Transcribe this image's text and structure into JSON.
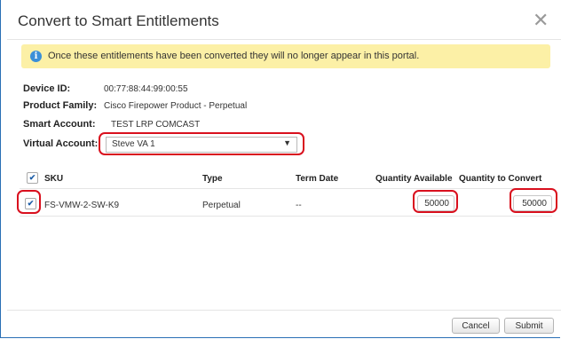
{
  "dialog": {
    "title": "Convert to Smart Entitlements",
    "close_glyph": "✕"
  },
  "alert": {
    "icon": "info-icon",
    "icon_glyph": "i",
    "message": "Once these entitlements have been converted they will no longer appear in this portal."
  },
  "fields": {
    "device_id_label": "Device ID:",
    "device_id_value": "00:77:88:44:99:00:55",
    "product_family_label": "Product Family:",
    "product_family_value": "Cisco Firepower Product - Perpetual",
    "smart_account_label": "Smart Account:",
    "smart_account_value": "TEST LRP COMCAST",
    "virtual_account_label": "Virtual Account:",
    "virtual_account_selected": "Steve VA 1",
    "caret_glyph": "▼"
  },
  "table": {
    "headers": {
      "sku": "SKU",
      "type": "Type",
      "term_date": "Term Date",
      "quantity_available": "Quantity Available",
      "quantity_to_convert": "Quantity to Convert"
    },
    "header_checked": true,
    "rows": [
      {
        "checked": true,
        "sku": "FS-VMW-2-SW-K9",
        "type": "Perpetual",
        "term_date": "--",
        "quantity_available": "50000",
        "quantity_to_convert": "50000"
      }
    ]
  },
  "footer": {
    "cancel_label": "Cancel",
    "submit_label": "Submit"
  },
  "colors": {
    "alert_background": "#fcf0a6",
    "info_icon": "#3b8fd8",
    "highlight_annotation": "#d9101e",
    "frame_border": "#2a6fb5"
  },
  "check_glyph": "✔"
}
